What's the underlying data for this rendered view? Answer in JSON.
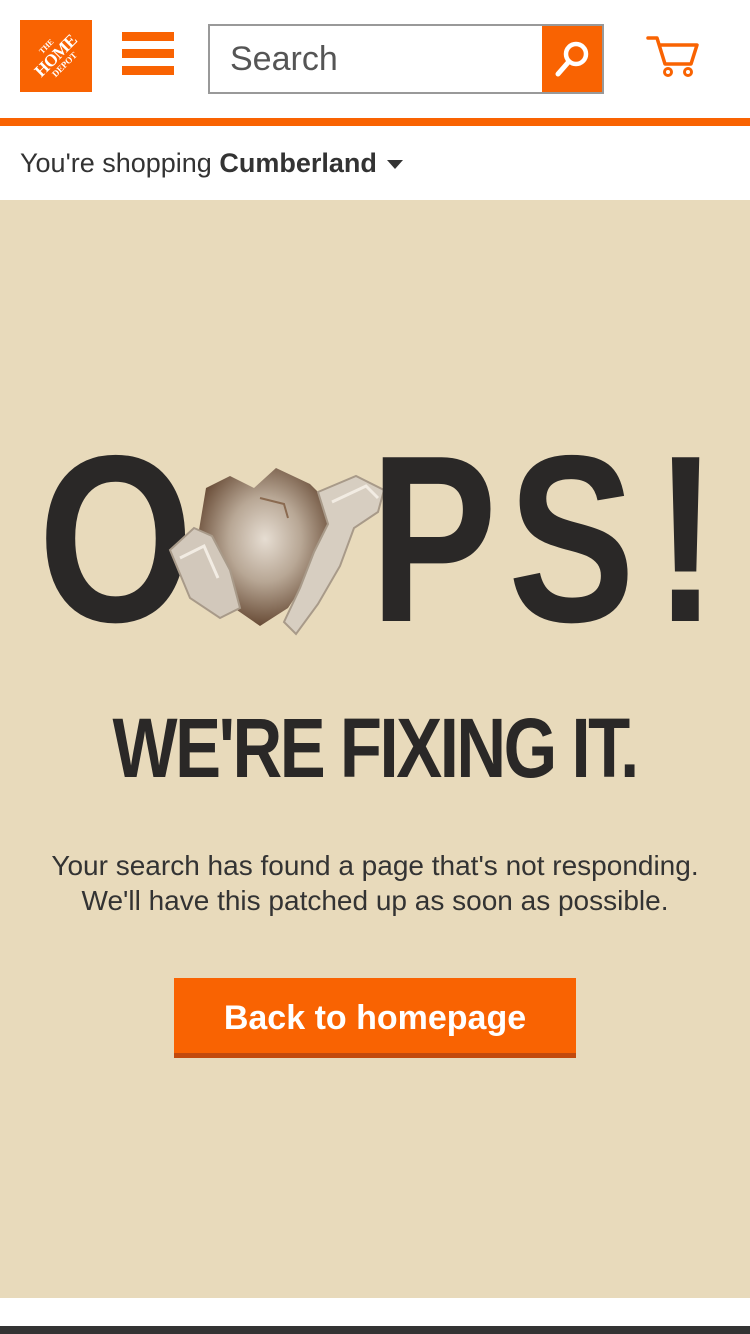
{
  "header": {
    "logo": {
      "line1": "THE",
      "line2": "HOME",
      "line3": "DEPOT"
    },
    "search": {
      "placeholder": "Search"
    }
  },
  "store": {
    "prefix": "You're shopping",
    "name": "Cumberland"
  },
  "error": {
    "oops": [
      "O",
      "P",
      "S",
      "!"
    ],
    "headline": "WE'RE FIXING IT.",
    "message_line1": "Your search has found a page that's not responding.",
    "message_line2": "We'll have this patched up as soon as possible.",
    "button_label": "Back to homepage"
  },
  "colors": {
    "brand": "#f96302",
    "background": "#e8dabb",
    "text_dark": "#2a2827"
  }
}
